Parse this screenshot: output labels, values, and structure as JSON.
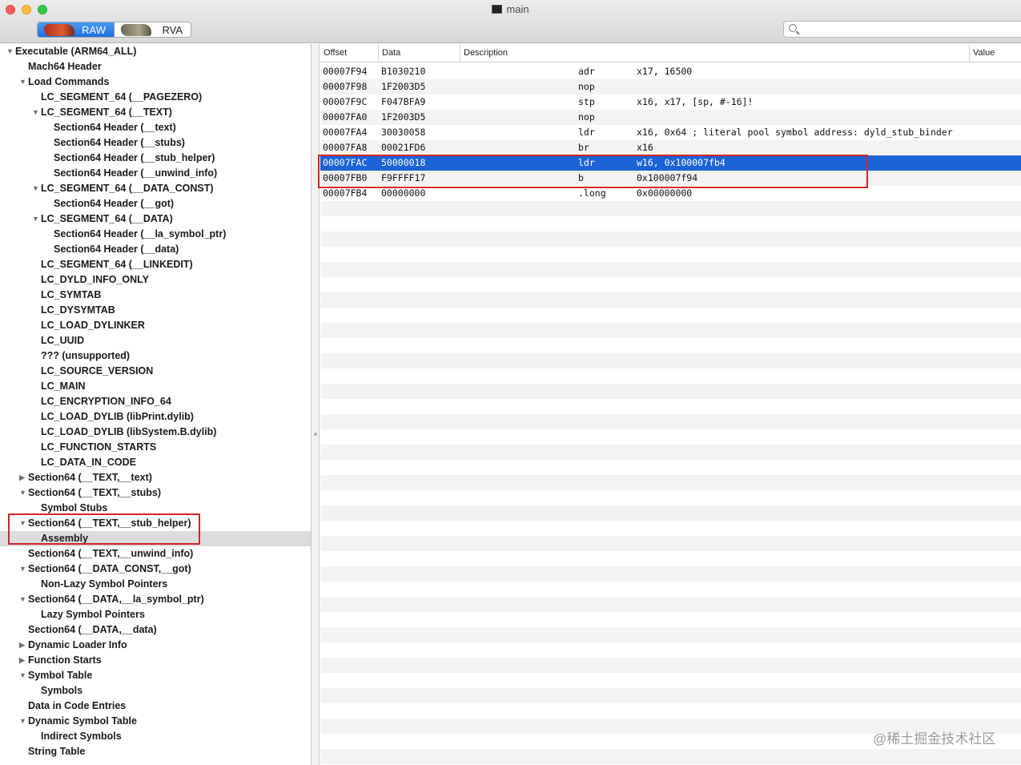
{
  "window": {
    "title": "main"
  },
  "toolbar": {
    "raw_label": "RAW",
    "rva_label": "RVA",
    "search_value": "",
    "search_placeholder": ""
  },
  "sidebar": {
    "items": [
      {
        "label": "Executable  (ARM64_ALL)",
        "depth": 0,
        "toggle": "expanded"
      },
      {
        "label": "Mach64 Header",
        "depth": 1,
        "toggle": "none"
      },
      {
        "label": "Load Commands",
        "depth": 1,
        "toggle": "expanded"
      },
      {
        "label": "LC_SEGMENT_64 (__PAGEZERO)",
        "depth": 2,
        "toggle": "none"
      },
      {
        "label": "LC_SEGMENT_64 (__TEXT)",
        "depth": 2,
        "toggle": "expanded"
      },
      {
        "label": "Section64 Header (__text)",
        "depth": 3,
        "toggle": "none"
      },
      {
        "label": "Section64 Header (__stubs)",
        "depth": 3,
        "toggle": "none"
      },
      {
        "label": "Section64 Header (__stub_helper)",
        "depth": 3,
        "toggle": "none"
      },
      {
        "label": "Section64 Header (__unwind_info)",
        "depth": 3,
        "toggle": "none"
      },
      {
        "label": "LC_SEGMENT_64 (__DATA_CONST)",
        "depth": 2,
        "toggle": "expanded"
      },
      {
        "label": "Section64 Header (__got)",
        "depth": 3,
        "toggle": "none"
      },
      {
        "label": "LC_SEGMENT_64 (__DATA)",
        "depth": 2,
        "toggle": "expanded"
      },
      {
        "label": "Section64 Header (__la_symbol_ptr)",
        "depth": 3,
        "toggle": "none"
      },
      {
        "label": "Section64 Header (__data)",
        "depth": 3,
        "toggle": "none"
      },
      {
        "label": "LC_SEGMENT_64 (__LINKEDIT)",
        "depth": 2,
        "toggle": "none"
      },
      {
        "label": "LC_DYLD_INFO_ONLY",
        "depth": 2,
        "toggle": "none"
      },
      {
        "label": "LC_SYMTAB",
        "depth": 2,
        "toggle": "none"
      },
      {
        "label": "LC_DYSYMTAB",
        "depth": 2,
        "toggle": "none"
      },
      {
        "label": "LC_LOAD_DYLINKER",
        "depth": 2,
        "toggle": "none"
      },
      {
        "label": "LC_UUID",
        "depth": 2,
        "toggle": "none"
      },
      {
        "label": "??? (unsupported)",
        "depth": 2,
        "toggle": "none"
      },
      {
        "label": "LC_SOURCE_VERSION",
        "depth": 2,
        "toggle": "none"
      },
      {
        "label": "LC_MAIN",
        "depth": 2,
        "toggle": "none"
      },
      {
        "label": "LC_ENCRYPTION_INFO_64",
        "depth": 2,
        "toggle": "none"
      },
      {
        "label": "LC_LOAD_DYLIB (libPrint.dylib)",
        "depth": 2,
        "toggle": "none"
      },
      {
        "label": "LC_LOAD_DYLIB (libSystem.B.dylib)",
        "depth": 2,
        "toggle": "none"
      },
      {
        "label": "LC_FUNCTION_STARTS",
        "depth": 2,
        "toggle": "none"
      },
      {
        "label": "LC_DATA_IN_CODE",
        "depth": 2,
        "toggle": "none"
      },
      {
        "label": "Section64 (__TEXT,__text)",
        "depth": 1,
        "toggle": "collapsed"
      },
      {
        "label": "Section64 (__TEXT,__stubs)",
        "depth": 1,
        "toggle": "expanded"
      },
      {
        "label": "Symbol Stubs",
        "depth": 2,
        "toggle": "none"
      },
      {
        "label": "Section64 (__TEXT,__stub_helper)",
        "depth": 1,
        "toggle": "expanded"
      },
      {
        "label": "Assembly",
        "depth": 2,
        "toggle": "none",
        "selected": true
      },
      {
        "label": "Section64 (__TEXT,__unwind_info)",
        "depth": 1,
        "toggle": "none"
      },
      {
        "label": "Section64 (__DATA_CONST,__got)",
        "depth": 1,
        "toggle": "expanded"
      },
      {
        "label": "Non-Lazy Symbol Pointers",
        "depth": 2,
        "toggle": "none"
      },
      {
        "label": "Section64 (__DATA,__la_symbol_ptr)",
        "depth": 1,
        "toggle": "expanded"
      },
      {
        "label": "Lazy Symbol Pointers",
        "depth": 2,
        "toggle": "none"
      },
      {
        "label": "Section64 (__DATA,__data)",
        "depth": 1,
        "toggle": "none"
      },
      {
        "label": "Dynamic Loader Info",
        "depth": 1,
        "toggle": "collapsed"
      },
      {
        "label": "Function Starts",
        "depth": 1,
        "toggle": "collapsed"
      },
      {
        "label": "Symbol Table",
        "depth": 1,
        "toggle": "expanded"
      },
      {
        "label": "Symbols",
        "depth": 2,
        "toggle": "none"
      },
      {
        "label": "Data in Code Entries",
        "depth": 1,
        "toggle": "none"
      },
      {
        "label": "Dynamic Symbol Table",
        "depth": 1,
        "toggle": "expanded"
      },
      {
        "label": "Indirect Symbols",
        "depth": 2,
        "toggle": "none"
      },
      {
        "label": "String Table",
        "depth": 1,
        "toggle": "none"
      }
    ]
  },
  "table": {
    "columns": {
      "offset": "Offset",
      "data": "Data",
      "description": "Description",
      "value": "Value"
    },
    "rows": [
      {
        "offset": "00007F94",
        "data": "B1030210",
        "mnemonic": "adr",
        "operands": "x17, 16500"
      },
      {
        "offset": "00007F98",
        "data": "1F2003D5",
        "mnemonic": "nop",
        "operands": ""
      },
      {
        "offset": "00007F9C",
        "data": "F047BFA9",
        "mnemonic": "stp",
        "operands": "x16, x17, [sp, #-16]!"
      },
      {
        "offset": "00007FA0",
        "data": "1F2003D5",
        "mnemonic": "nop",
        "operands": ""
      },
      {
        "offset": "00007FA4",
        "data": "30030058",
        "mnemonic": "ldr",
        "operands": "x16, 0x64 ; literal pool symbol address: dyld_stub_binder"
      },
      {
        "offset": "00007FA8",
        "data": "00021FD6",
        "mnemonic": "br",
        "operands": "x16"
      },
      {
        "offset": "00007FAC",
        "data": "50000018",
        "mnemonic": "ldr",
        "operands": "w16, 0x100007fb4",
        "selected": true
      },
      {
        "offset": "00007FB0",
        "data": "F9FFFF17",
        "mnemonic": "b",
        "operands": "0x100007f94"
      },
      {
        "offset": "00007FB4",
        "data": "00000000",
        "mnemonic": ".long",
        "operands": "0x00000000"
      }
    ]
  },
  "watermark": "@稀土掘金技术社区",
  "colors": {
    "selection": "#1b63d6",
    "annotation_box": "#d42424",
    "sidebar_selection": "#dcdcdc"
  },
  "icons": {
    "search": "search-icon",
    "expanded": "disclosure-triangle-down-icon",
    "collapsed": "disclosure-triangle-right-icon"
  }
}
